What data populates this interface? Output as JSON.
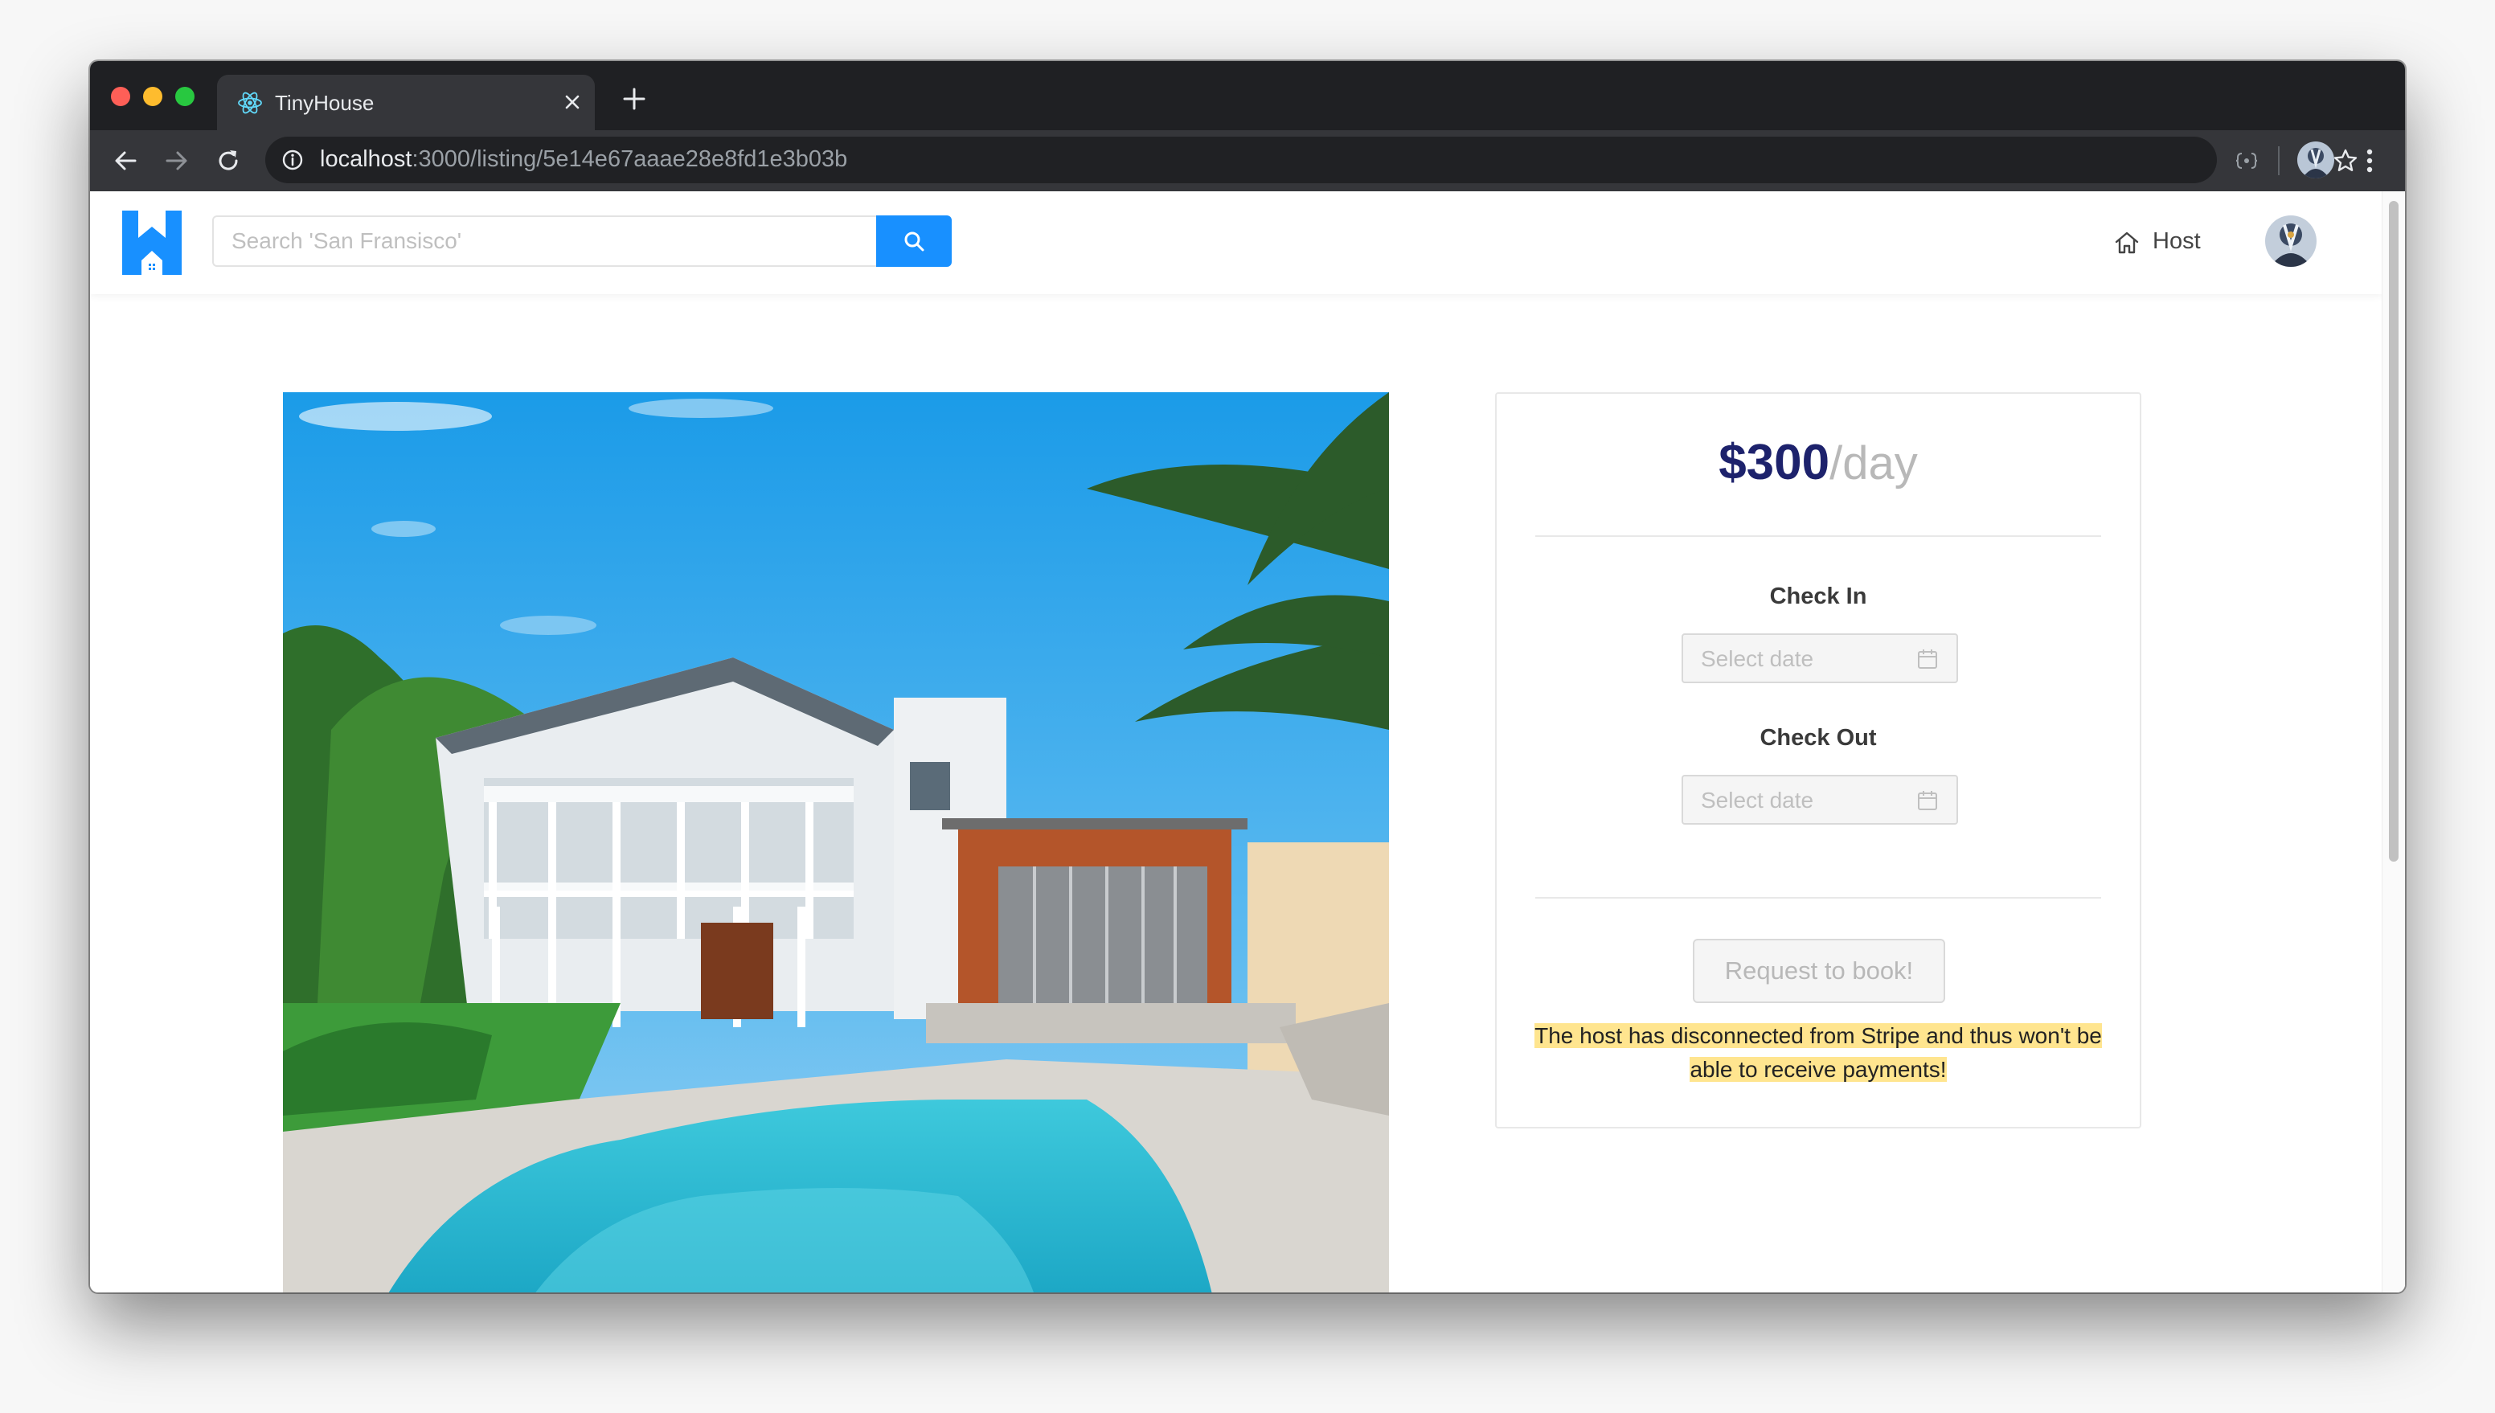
{
  "browser": {
    "tab": {
      "title": "TinyHouse",
      "favicon": "react-icon"
    },
    "url": {
      "host": "localhost",
      "rest": ":3000/listing/5e14e67aaae28e8fd1e3b03b"
    }
  },
  "header": {
    "search": {
      "placeholder": "Search 'San Fransisco'"
    },
    "host_label": "Host"
  },
  "listing": {
    "image_alt": "white two-storey house with pool and palm trees",
    "booking": {
      "price": "$300",
      "price_unit": "/day",
      "check_in_label": "Check In",
      "check_in_placeholder": "Select date",
      "check_out_label": "Check Out",
      "check_out_placeholder": "Select date",
      "request_button": "Request to book!",
      "warning": "The host has disconnected from Stripe and thus won't be able to receive payments!"
    }
  },
  "colors": {
    "brand": "#1890ff",
    "price": "#1d226c",
    "warning_highlight": "#ffe58f"
  }
}
